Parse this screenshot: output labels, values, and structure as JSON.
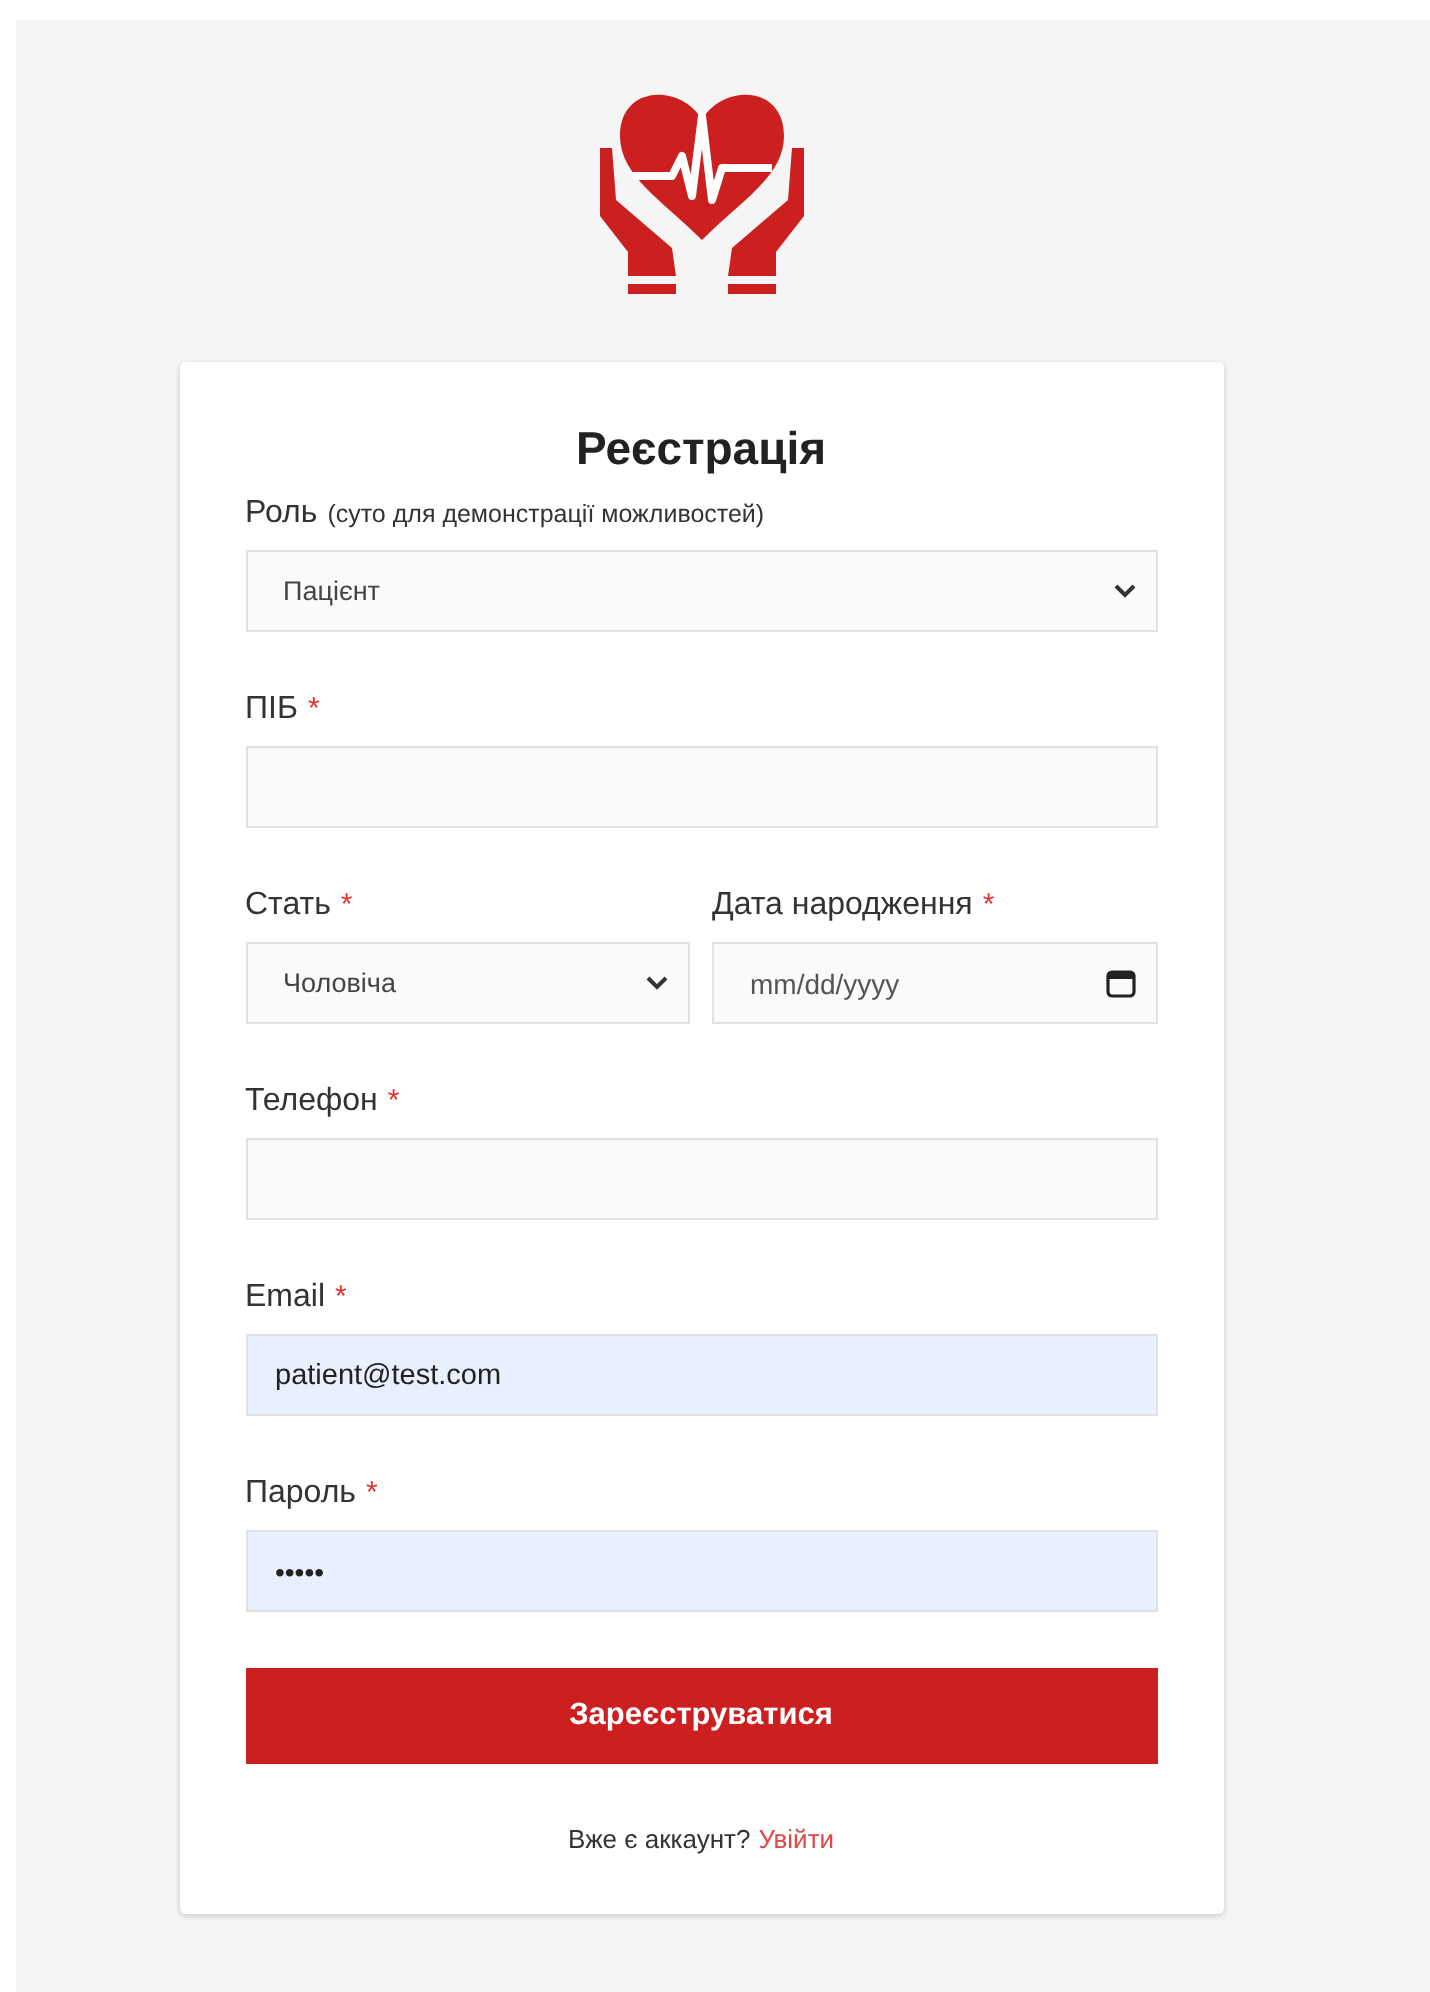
{
  "title": "Реєстрація",
  "rows": [
    {
      "fields": [
        {
          "kind": "select",
          "label": "Роль",
          "note": "(суто для демонстрації можливостей)",
          "value": "Пацієнт",
          "autofilled": false
        }
      ]
    },
    {
      "fields": [
        {
          "kind": "text",
          "label": "ПІБ",
          "mark": "*",
          "autofilled": false
        }
      ]
    },
    {
      "fields": [
        {
          "kind": "select",
          "label": "Стать",
          "mark": "*",
          "value": "Чоловіча",
          "autofilled": false
        },
        {
          "kind": "date",
          "label": "Дата народження",
          "mark": "*",
          "placeholder": "mm/dd/yyyy",
          "autofilled": false
        }
      ]
    },
    {
      "fields": [
        {
          "kind": "text",
          "label": "Телефон",
          "mark": "*",
          "autofilled": false
        }
      ]
    },
    {
      "fields": [
        {
          "kind": "text",
          "label": "Email",
          "mark": "*",
          "value": "patient@test.com",
          "autofilled": true
        }
      ]
    },
    {
      "fields": [
        {
          "kind": "password",
          "label": "Пароль",
          "mark": "*",
          "value": "•••••",
          "autofilled": true
        }
      ]
    }
  ],
  "submit": "Зареєструватися",
  "footer": {
    "text": "Вже є аккаунт?",
    "link": "Увійти"
  }
}
